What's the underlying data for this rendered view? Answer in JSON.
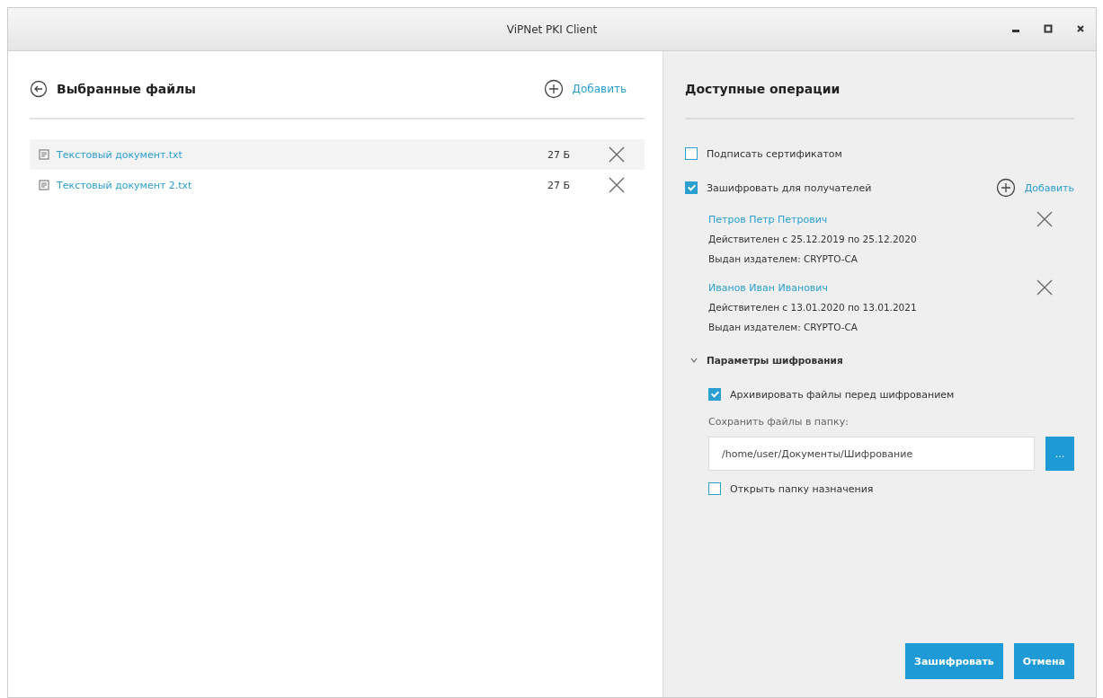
{
  "window": {
    "title": "ViPNet PKI Client"
  },
  "files_panel": {
    "title": "Выбранные файлы",
    "add_label": "Добавить",
    "files": [
      {
        "name": "Текстовый документ.txt",
        "size": "27 Б",
        "selected": true
      },
      {
        "name": "Текстовый документ 2.txt",
        "size": "27 Б",
        "selected": false
      }
    ]
  },
  "operations_panel": {
    "title": "Доступные операции",
    "sign": {
      "label": "Подписать сертификатом",
      "checked": false
    },
    "encrypt": {
      "label": "Зашифровать для получателей",
      "checked": true,
      "add_label": "Добавить"
    },
    "recipients": [
      {
        "name": "Петров Петр Петрович",
        "validity": "Действителен с 25.12.2019 по 25.12.2020",
        "issuer": "Выдан издателем: CRYPTO-CA"
      },
      {
        "name": "Иванов Иван Иванович",
        "validity": "Действителен с 13.01.2020 по 13.01.2021",
        "issuer": "Выдан издателем: CRYPTO-CA"
      }
    ],
    "params": {
      "title": "Параметры шифрования",
      "expanded": true,
      "archive": {
        "label": "Архивировать файлы перед шифрованием",
        "checked": true
      },
      "folder_label": "Сохранить файлы в папку:",
      "folder_value": "/home/user/Документы/Шифрование",
      "browse_label": "...",
      "open_folder": {
        "label": "Открыть папку назначения",
        "checked": false
      }
    },
    "buttons": [
      "Зашифровать",
      "Отмена"
    ]
  }
}
